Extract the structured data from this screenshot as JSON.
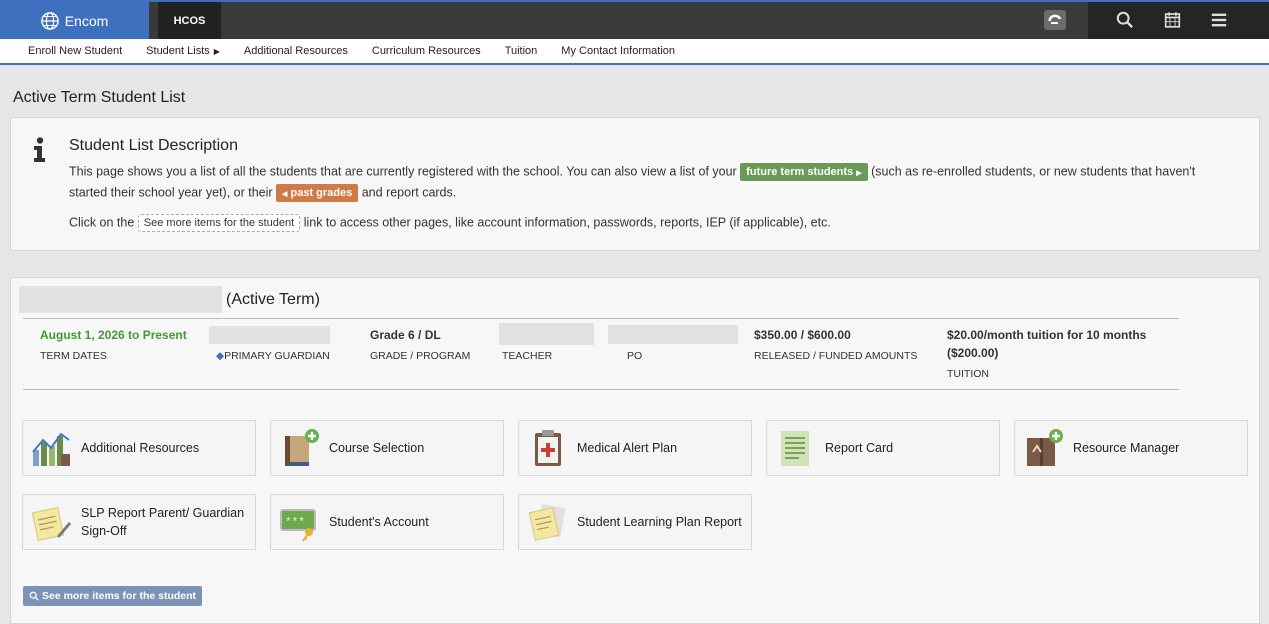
{
  "app": {
    "brand": "Encom",
    "school": "HCOS"
  },
  "menu": [
    {
      "label": "Enroll New Student"
    },
    {
      "label": "Student Lists",
      "has_caret": true
    },
    {
      "label": "Additional Resources"
    },
    {
      "label": "Curriculum Resources"
    },
    {
      "label": "Tuition"
    },
    {
      "label": "My Contact Information"
    }
  ],
  "page_title": "Active Term Student List",
  "description": {
    "title": "Student List Description",
    "line1_a": "This page shows you a list of all the students that are currently registered with the school. You can also view a list of your",
    "future_link": "future term students",
    "line1_b": "(such as re-enrolled students, or new students that haven't",
    "line2_a": "started their school year yet), or their",
    "past_link": "past grades",
    "line2_b": "and report cards.",
    "line3_a": "Click on the",
    "see_more_inline": "See more items for the student",
    "line3_b": "link to access other pages, like account information, passwords, reports, IEP (if applicable), etc."
  },
  "student": {
    "term_status": "(Active Term)",
    "term_dates_value": "August 1, 2026 to Present",
    "term_dates_label": "TERM DATES",
    "guardian_label": "PRIMARY GUARDIAN",
    "grade_value": "Grade 6 / DL",
    "grade_label": "GRADE / PROGRAM",
    "teacher_label": "TEACHER",
    "po_label": "PO",
    "funded_value": "$350.00 / $600.00",
    "funded_label": "RELEASED / FUNDED AMOUNTS",
    "tuition_value_1": "$20.00/month tuition for 10 months",
    "tuition_value_2": "($200.00)",
    "tuition_label": "TUITION"
  },
  "tiles": [
    {
      "label": "Additional Resources",
      "icon": "chart-icon"
    },
    {
      "label": "Course Selection",
      "icon": "book-add-icon"
    },
    {
      "label": "Medical Alert Plan",
      "icon": "clipboard-medical-icon"
    },
    {
      "label": "Report Card",
      "icon": "document-icon"
    },
    {
      "label": "Resource Manager",
      "icon": "box-add-icon"
    },
    {
      "label": "SLP Report Parent/ Guardian Sign-Off",
      "icon": "notepad-pencil-icon"
    },
    {
      "label": "Student's Account",
      "icon": "password-key-icon"
    },
    {
      "label": "Student Learning Plan Report",
      "icon": "notepad-icon"
    }
  ],
  "see_more_button": "See more items for the student",
  "colors": {
    "brand_blue": "#3f6fbf",
    "green_pill": "#6a9a57",
    "orange_pill": "#d27a45",
    "term_green": "#3f9a2f"
  }
}
